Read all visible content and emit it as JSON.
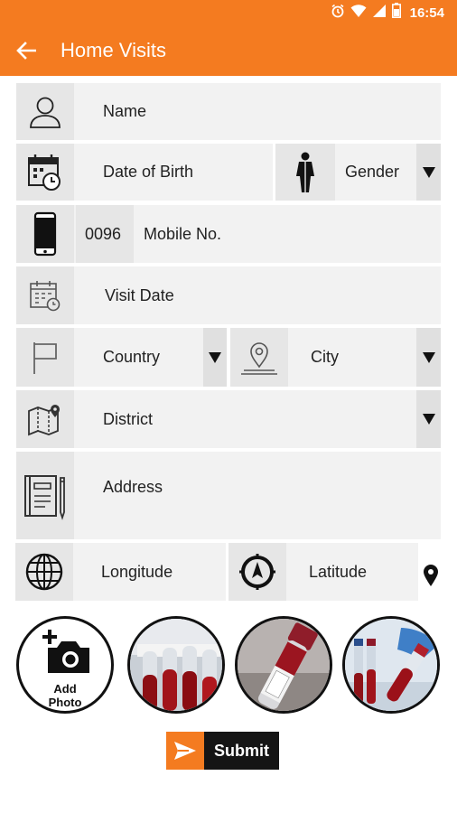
{
  "status_bar": {
    "time": "16:54"
  },
  "app_bar": {
    "title": "Home Visits"
  },
  "form": {
    "name_placeholder": "Name",
    "dob_placeholder": "Date of Birth",
    "gender_label": "Gender",
    "mobile_prefix": "0096",
    "mobile_placeholder": "Mobile No.",
    "visit_date_placeholder": "Visit Date",
    "country_label": "Country",
    "city_label": "City",
    "district_label": "District",
    "address_placeholder": "Address",
    "longitude_placeholder": "Longitude",
    "latitude_placeholder": "Latitude"
  },
  "photos": {
    "add_line1": "Add",
    "add_line2": "Photo"
  },
  "submit_label": "Submit",
  "colors": {
    "accent": "#f47b20",
    "field_bg": "#f2f2f2",
    "icon_bg": "#e6e6e6",
    "submit_dark": "#151515"
  }
}
